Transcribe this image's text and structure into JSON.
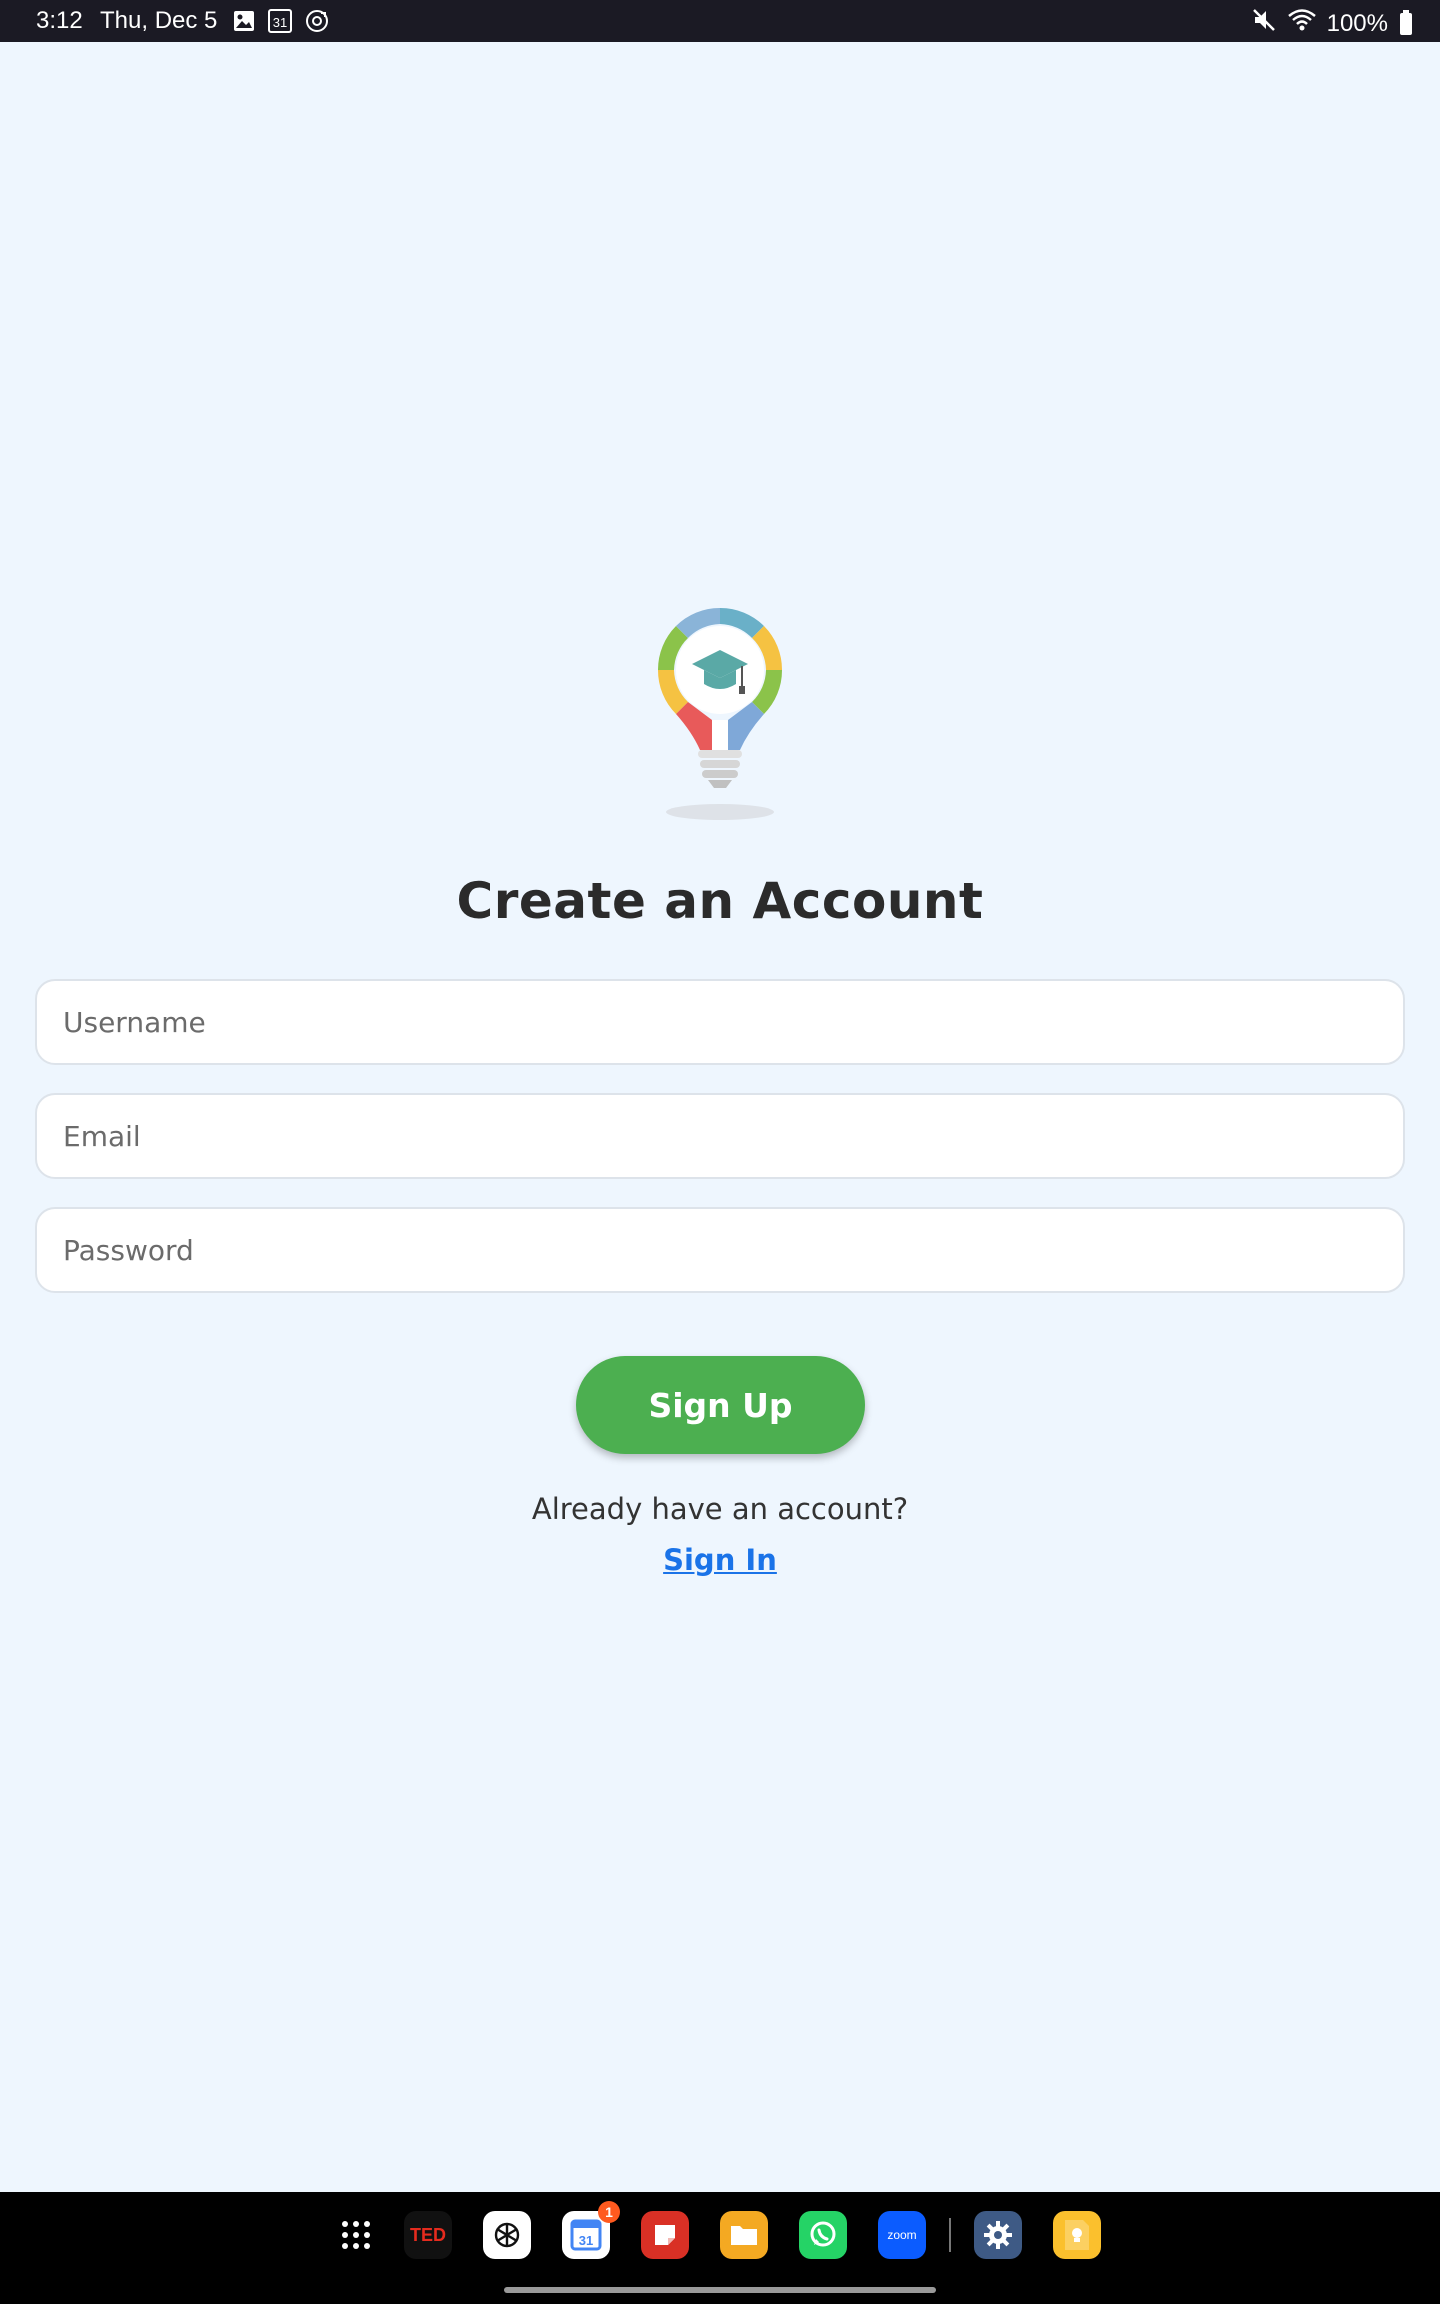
{
  "status_bar": {
    "time": "3:12",
    "date": "Thu, Dec 5",
    "calendar_day": "31",
    "battery": "100%",
    "icons": [
      "gallery-icon",
      "calendar-icon",
      "sync-icon",
      "mute-icon",
      "wifi-icon",
      "battery-icon"
    ]
  },
  "main": {
    "title": "Create an Account",
    "username_placeholder": "Username",
    "email_placeholder": "Email",
    "password_placeholder": "Password",
    "signup_label": "Sign Up",
    "already_text": "Already have an account?",
    "signin_label": "Sign In"
  },
  "taskbar": {
    "apps": [
      {
        "name": "app-drawer",
        "icon": "grid-icon"
      },
      {
        "name": "TED",
        "label": "TED"
      },
      {
        "name": "ChatGPT",
        "icon": "openai-icon"
      },
      {
        "name": "Calendar",
        "label": "31",
        "badge": "1"
      },
      {
        "name": "Notes",
        "icon": "note-icon"
      },
      {
        "name": "Files",
        "icon": "folder-icon"
      },
      {
        "name": "WhatsApp",
        "icon": "whatsapp-icon"
      },
      {
        "name": "Zoom",
        "label": "zoom"
      },
      {
        "name": "Settings",
        "icon": "gear-icon"
      },
      {
        "name": "Keep",
        "icon": "bulb-icon"
      }
    ]
  },
  "colors": {
    "background": "#eef6fe",
    "signup_button": "#4caf50",
    "link": "#1a73e8",
    "status_bar": "#1b1a24"
  }
}
